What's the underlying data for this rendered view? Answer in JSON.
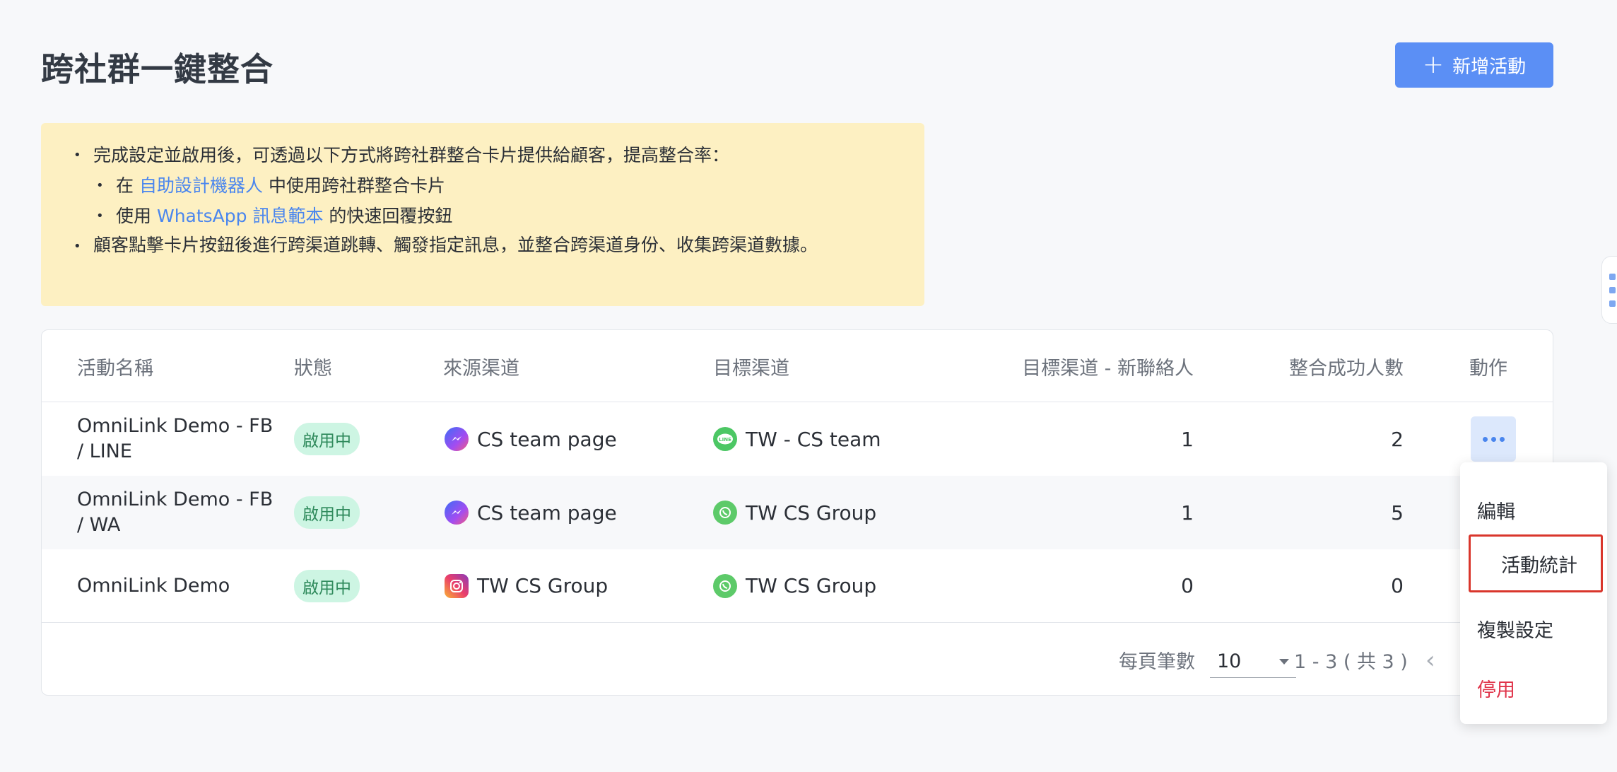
{
  "page": {
    "title": "跨社群一鍵整合"
  },
  "header": {
    "add_button_label": "新增活動"
  },
  "notice": {
    "line1": "完成設定並啟用後，可透過以下方式將跨社群整合卡片提供給顧客，提高整合率：",
    "sub1_prefix": "在",
    "sub1_link": "自助設計機器人",
    "sub1_suffix": "中使用跨社群整合卡片",
    "sub2_prefix": "使用",
    "sub2_link": "WhatsApp 訊息範本",
    "sub2_suffix": "的快速回覆按鈕",
    "line2": "顧客點擊卡片按鈕後進行跨渠道跳轉、觸發指定訊息，並整合跨渠道身份、收集跨渠道數據。"
  },
  "table": {
    "columns": {
      "name": "活動名稱",
      "status": "狀態",
      "source": "來源渠道",
      "target": "目標渠道",
      "new_contacts": "目標渠道 - 新聯絡人",
      "merged": "整合成功人數",
      "action": "動作"
    },
    "rows": [
      {
        "name": "OmniLink Demo - FB / LINE",
        "status": "啟用中",
        "source": "CS team page",
        "source_icon": "messenger-icon",
        "target": "TW - CS team",
        "target_icon": "line-icon",
        "new_contacts": "1",
        "merged": "2"
      },
      {
        "name": "OmniLink Demo - FB / WA",
        "status": "啟用中",
        "source": "CS team page",
        "source_icon": "messenger-icon",
        "target": "TW CS Group",
        "target_icon": "whatsapp-icon",
        "new_contacts": "1",
        "merged": "5"
      },
      {
        "name": "OmniLink Demo",
        "status": "啟用中",
        "source": "TW CS Group",
        "source_icon": "instagram-icon",
        "target": "TW CS Group",
        "target_icon": "whatsapp-icon",
        "new_contacts": "0",
        "merged": "0"
      }
    ]
  },
  "pagination": {
    "per_page_label": "每頁筆數",
    "per_page_value": "10",
    "range_text": "1 - 3 ( 共 3 )"
  },
  "action_menu": {
    "items": [
      "編輯",
      "活動統計",
      "複製設定",
      "停用"
    ]
  },
  "colors": {
    "primary": "#5b8ff5",
    "notice_bg": "#fdf0c2",
    "badge_bg": "#cdf5e3",
    "danger": "#e0344a",
    "highlight_border": "#d9362c"
  }
}
